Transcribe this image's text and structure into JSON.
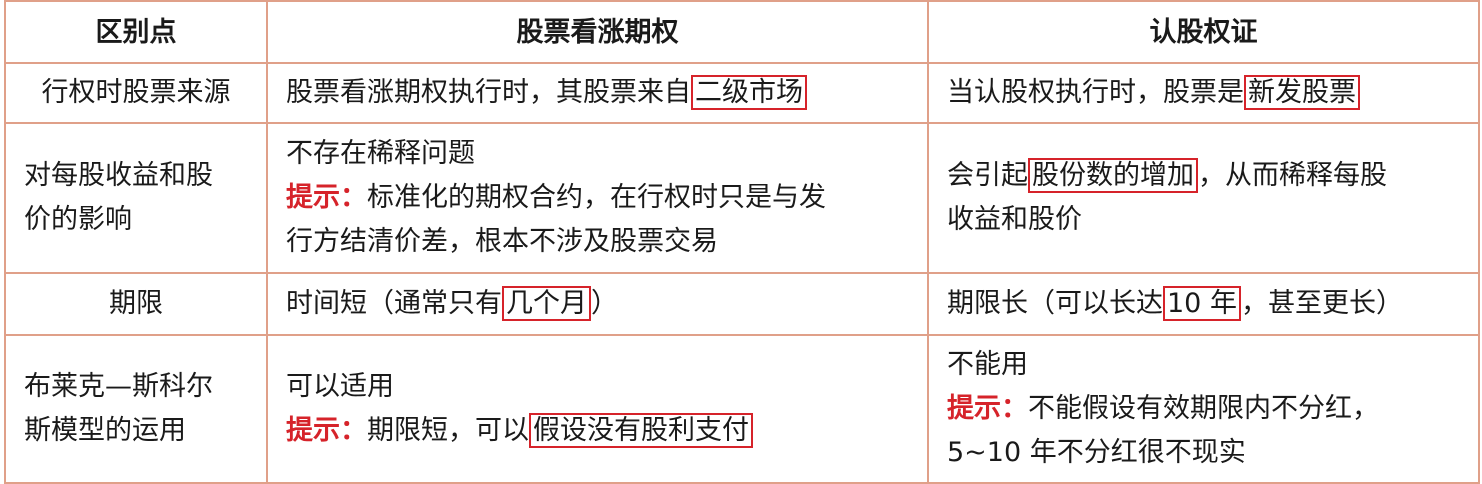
{
  "header": {
    "col1": "区别点",
    "col2": "股票看涨期权",
    "col3": "认股权证"
  },
  "rows": [
    {
      "point": "行权时股票来源",
      "option": {
        "pre": "股票看涨期权执行时，其股票来自",
        "hl": "二级市场"
      },
      "warrant": {
        "pre": "当认股权执行时，股票是",
        "hl": "新发股票"
      }
    },
    {
      "point_lines": [
        "对每股收益和股",
        "价的影响"
      ],
      "option": {
        "line1": "不存在稀释问题",
        "tip_label": "提示：",
        "tip_text": "标准化的期权合约，在行权时只是与发",
        "line3": "行方结清价差，根本不涉及股票交易"
      },
      "warrant": {
        "pre": "会引起",
        "hl": "股份数的增加",
        "post": "，从而稀释每股",
        "line2": "收益和股价"
      }
    },
    {
      "point": "期限",
      "option": {
        "pre": "时间短（通常只有",
        "hl": "几个月",
        "post": "）"
      },
      "warrant": {
        "pre": "期限长（可以长达",
        "hl": "10 年",
        "post": "，甚至更长）"
      }
    },
    {
      "point_lines": [
        "布莱克—斯科尔",
        "斯模型的运用"
      ],
      "option": {
        "line1": "可以适用",
        "tip_label": "提示：",
        "tip_pre": "期限短，可以",
        "tip_hl": "假设没有股利支付"
      },
      "warrant": {
        "line1": "不能用",
        "tip_label": "提示：",
        "tip_text": "不能假设有效期限内不分红，",
        "line3": "5~10 年不分红很不现实"
      }
    }
  ]
}
